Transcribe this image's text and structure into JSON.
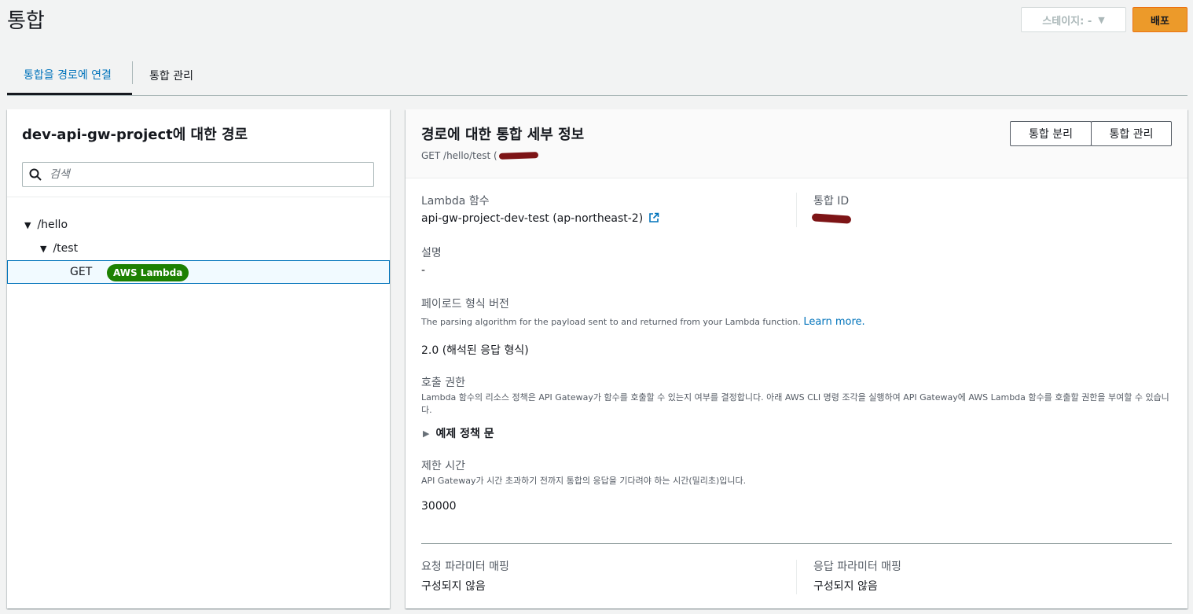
{
  "page": {
    "title": "통합"
  },
  "header": {
    "stage_label": "스테이지: -",
    "deploy_label": "배포"
  },
  "tabs": [
    {
      "label": "통합을 경로에 연결",
      "active": true
    },
    {
      "label": "통합 관리",
      "active": false
    }
  ],
  "routes_panel": {
    "title": "dev-api-gw-project에 대한 경로",
    "search_placeholder": "검색",
    "tree": [
      {
        "label": "/hello"
      },
      {
        "label": "/test"
      },
      {
        "method": "GET",
        "badge": "AWS Lambda"
      }
    ]
  },
  "details": {
    "title": "경로에 대한 통합 세부 정보",
    "route": "GET /hello/test (",
    "detach_label": "통합 분리",
    "manage_label": "통합 관리",
    "lambda_label": "Lambda 함수",
    "lambda_value": "api-gw-project-dev-test (ap-northeast-2)",
    "integration_id_label": "통합 ID",
    "description_label": "설명",
    "description_value": "-",
    "payload_label": "페이로드 형식 버전",
    "payload_desc": "The parsing algorithm for the payload sent to and returned from your Lambda function.",
    "payload_link": "Learn more.",
    "payload_value": "2.0 (해석된 응답 형식)",
    "permission_label": "호출 권한",
    "permission_desc": "Lambda 함수의 리소스 정책은 API Gateway가 함수를 호출할 수 있는지 여부를 결정합니다. 아래 AWS CLI 명령 조각을 실행하여 API Gateway에 AWS Lambda 함수를 호출할 권한을 부여할 수 있습니다.",
    "example_policy": "예제 정책 문",
    "timeout_label": "제한 시간",
    "timeout_desc": "API Gateway가 시간 초과하기 전까지 통합의 응답을 기다려야 하는 시간(밀리초)입니다.",
    "timeout_value": "30000",
    "request_mapping_label": "요청 파라미터 매핑",
    "request_mapping_value": "구성되지 않음",
    "response_mapping_label": "응답 파라미터 매핑",
    "response_mapping_value": "구성되지 않음"
  },
  "colors": {
    "accent": "#0073bb",
    "deploy": "#ec9a2a",
    "lambda_badge": "#1d8102",
    "redaction": "#7d1416"
  }
}
